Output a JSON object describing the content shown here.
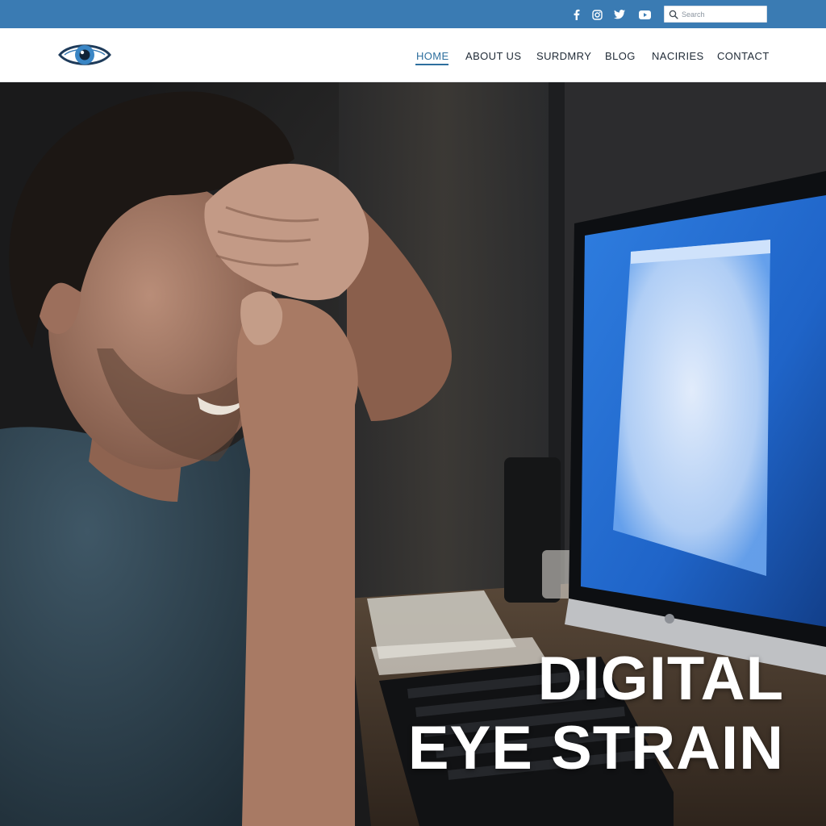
{
  "topbar": {
    "social_icons": [
      "facebook-icon",
      "instagram-icon",
      "twitter-icon",
      "youtube-icon"
    ],
    "search": {
      "placeholder": "Search",
      "value": ""
    }
  },
  "header": {
    "logo": "eye-logo",
    "nav": [
      {
        "label": "HOME",
        "active": true
      },
      {
        "label": "ABOUT US",
        "active": false
      },
      {
        "label": "SURDMRY",
        "active": false
      },
      {
        "label": "BLOG",
        "active": false
      },
      {
        "label": "NACIRIES",
        "active": false
      },
      {
        "label": "CONTACT",
        "active": false
      }
    ]
  },
  "hero": {
    "title_line1": "DIGITAL",
    "title_line2": "EYE STRAIN"
  },
  "colors": {
    "topbar": "#3a7bb3",
    "nav_active": "#2e6f9e",
    "nav_text": "#1f2a36",
    "monitor_glow": "#2f7ee0"
  }
}
